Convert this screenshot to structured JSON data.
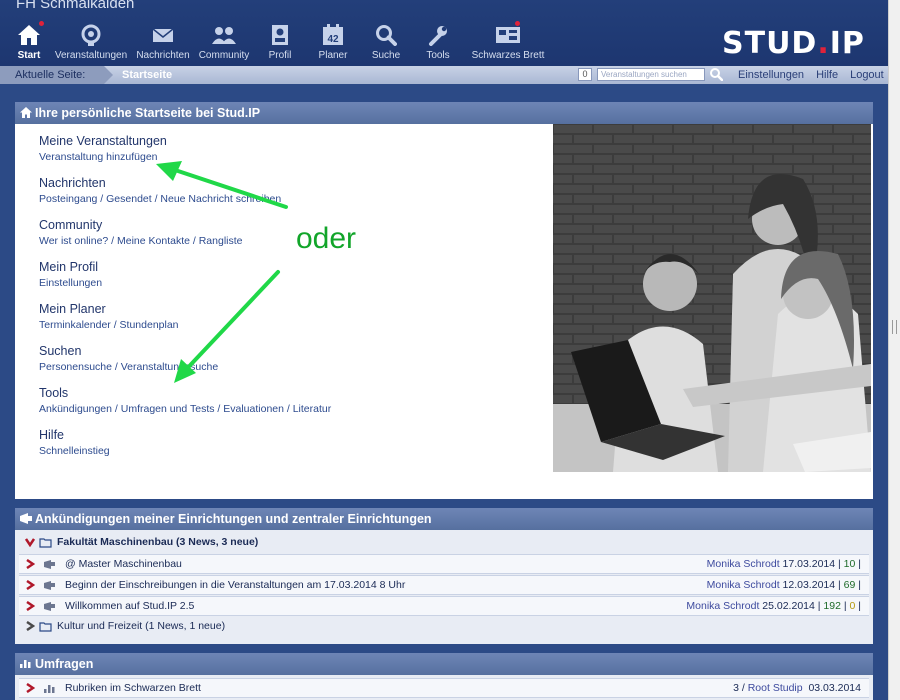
{
  "header": {
    "university": "FH Schmalkalden",
    "logo": {
      "main": "STUD",
      "dot": ".",
      "suffix": "IP"
    },
    "nav": [
      {
        "label": "Start",
        "icon": "home-icon",
        "active": true,
        "badge": true
      },
      {
        "label": "Veranstaltungen",
        "icon": "seminar-icon",
        "active": false,
        "badge": false
      },
      {
        "label": "Nachrichten",
        "icon": "mail-icon",
        "active": false,
        "badge": false
      },
      {
        "label": "Community",
        "icon": "people-icon",
        "active": false,
        "badge": false
      },
      {
        "label": "Profil",
        "icon": "profile-icon",
        "active": false,
        "badge": false
      },
      {
        "label": "Planer",
        "icon": "calendar-icon",
        "active": false,
        "badge": false,
        "day": "42"
      },
      {
        "label": "Suche",
        "icon": "search-icon",
        "active": false,
        "badge": false
      },
      {
        "label": "Tools",
        "icon": "wrench-icon",
        "active": false,
        "badge": false
      },
      {
        "label": "Schwarzes Brett",
        "icon": "board-icon",
        "active": false,
        "badge": true
      }
    ]
  },
  "crumbbar": {
    "label": "Aktuelle Seite:",
    "page": "Startseite",
    "quick_count": "0",
    "search_placeholder": "Veranstaltungen suchen",
    "links": [
      "Einstellungen",
      "Hilfe",
      "Logout"
    ]
  },
  "start": {
    "title": "Ihre persönliche Startseite bei Stud.IP",
    "groups": [
      {
        "title": "Meine Veranstaltungen",
        "sub": "Veranstaltung hinzufügen"
      },
      {
        "title": "Nachrichten",
        "sub": "Posteingang / Gesendet / Neue Nachricht schreiben"
      },
      {
        "title": "Community",
        "sub": "Wer ist online? / Meine Kontakte / Rangliste"
      },
      {
        "title": "Mein Profil",
        "sub": "Einstellungen"
      },
      {
        "title": "Mein Planer",
        "sub": "Terminkalender / Stundenplan"
      },
      {
        "title": "Suchen",
        "sub": "Personensuche / Veranstaltungssuche"
      },
      {
        "title": "Tools",
        "sub": "Ankündigungen / Umfragen und Tests / Evaluationen / Literatur"
      },
      {
        "title": "Hilfe",
        "sub": "Schnelleinstieg"
      }
    ],
    "annotation": "oder",
    "accent": "#12a52a"
  },
  "news": {
    "title": "Ankündigungen meiner Einrichtungen und zentraler Einrichtungen",
    "group1": "Fakultät Maschinenbau (3 News, 3 neue)",
    "items": [
      {
        "title": "@ Master Maschinenbau",
        "author": "Monika Schrodt",
        "date": "17.03.2014",
        "count": "10",
        "new": ""
      },
      {
        "title": "Beginn der Einschreibungen in die Veranstaltungen am 17.03.2014 8 Uhr",
        "author": "Monika Schrodt",
        "date": "12.03.2014",
        "count": "69",
        "new": ""
      },
      {
        "title": "Willkommen auf Stud.IP 2.5",
        "author": "Monika Schrodt",
        "date": "25.02.2014",
        "count": "192",
        "new": "0"
      }
    ],
    "group2": "Kultur und Freizeit (1 News, 1 neue)"
  },
  "polls": {
    "title": "Umfragen",
    "item": {
      "title": "Rubriken im Schwarzen Brett",
      "count": "3",
      "author": "Root Studip",
      "date": "03.03.2014"
    }
  }
}
